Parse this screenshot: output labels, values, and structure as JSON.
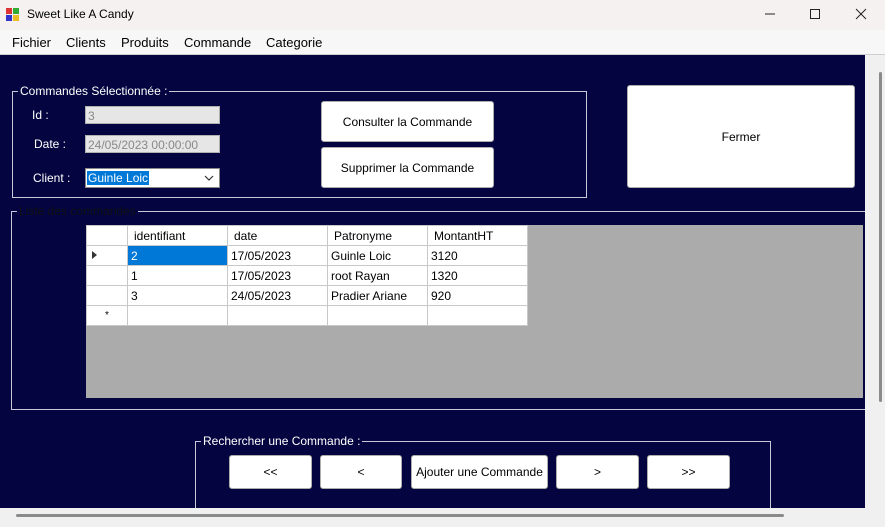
{
  "window": {
    "title": "Sweet Like A Candy"
  },
  "menu": [
    "Fichier",
    "Clients",
    "Produits",
    "Commande",
    "Categorie"
  ],
  "selected_group": {
    "legend": "Commandes Sélectionnée :",
    "id_label": "Id :",
    "id_value": "3",
    "date_label": "Date :",
    "date_value": "24/05/2023 00:00:00",
    "client_label": "Client :",
    "client_value": "Guinle Loic"
  },
  "buttons": {
    "consult": "Consulter la Commande",
    "delete": "Supprimer la Commande",
    "close": "Fermer"
  },
  "list_group": {
    "legend": "Liste des commandes"
  },
  "grid": {
    "columns": [
      "identifiant",
      "date",
      "Patronyme",
      "MontantHT"
    ],
    "rows": [
      [
        "2",
        "17/05/2023",
        "Guinle Loic",
        "3120"
      ],
      [
        "1",
        "17/05/2023",
        "root Rayan",
        "1320"
      ],
      [
        "3",
        "24/05/2023",
        "Pradier Ariane",
        "920"
      ]
    ],
    "new_row_marker": "*"
  },
  "search_group": {
    "legend": "Rechercher une Commande :",
    "first": "<<",
    "prev": "<",
    "add": "Ajouter une Commande",
    "next": ">",
    "last": ">>"
  },
  "colors": {
    "form_bg": "#040440",
    "selection": "#0078d7",
    "grid_bg": "#ababab"
  }
}
